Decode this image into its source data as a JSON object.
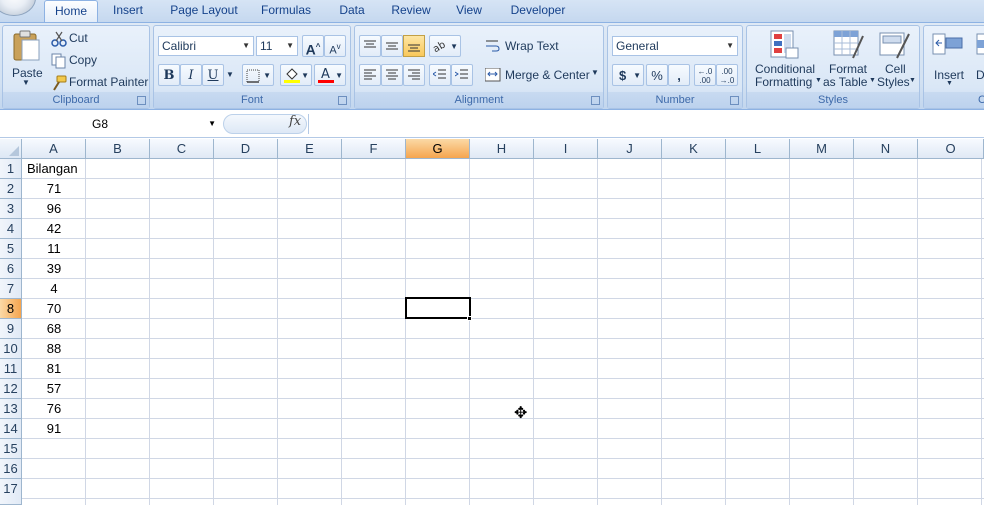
{
  "tabs": [
    "Home",
    "Insert",
    "Page Layout",
    "Formulas",
    "Data",
    "Review",
    "View",
    "Developer"
  ],
  "active_tab": "Home",
  "clipboard": {
    "paste_label": "Paste",
    "cut_label": "Cut",
    "copy_label": "Copy",
    "format_painter_label": "Format Painter",
    "group_label": "Clipboard"
  },
  "font": {
    "font_name": "Calibri",
    "font_size": "11",
    "bold": "B",
    "italic": "I",
    "underline": "U",
    "grow": "A",
    "shrink": "A",
    "group_label": "Font",
    "fill_color": "#ffff00",
    "font_color": "#ff0000"
  },
  "alignment": {
    "wrap_text_label": "Wrap Text",
    "merge_center_label": "Merge & Center",
    "group_label": "Alignment"
  },
  "number": {
    "format": "General",
    "currency": "$",
    "percent": "%",
    "comma": ",",
    "increase_decimal": "←.0\n.00",
    "decrease_decimal": ".00\n→.0",
    "group_label": "Number"
  },
  "styles": {
    "conditional_formatting_line1": "Conditional",
    "conditional_formatting_line2": "Formatting",
    "format_as_table_line1": "Format",
    "format_as_table_line2": "as Table",
    "cell_styles_line1": "Cell",
    "cell_styles_line2": "Styles",
    "group_label": "Styles"
  },
  "cells_group": {
    "insert_label": "Insert",
    "delete_label": "De",
    "group_label": "C"
  },
  "formula_bar": {
    "name_box": "G8",
    "fx": "fx",
    "formula": ""
  },
  "columns": [
    "A",
    "B",
    "C",
    "D",
    "E",
    "F",
    "G",
    "H",
    "I",
    "J",
    "K",
    "L",
    "M",
    "N",
    "O"
  ],
  "rows": [
    "1",
    "2",
    "3",
    "4",
    "5",
    "6",
    "7",
    "8",
    "9",
    "10",
    "11",
    "12",
    "13",
    "14",
    "15",
    "16",
    "17"
  ],
  "selected_column": "G",
  "selected_row": "8",
  "column_a": {
    "header": "Bilangan",
    "values": [
      "71",
      "96",
      "42",
      "11",
      "39",
      "4",
      "70",
      "68",
      "88",
      "81",
      "57",
      "76",
      "91"
    ]
  }
}
